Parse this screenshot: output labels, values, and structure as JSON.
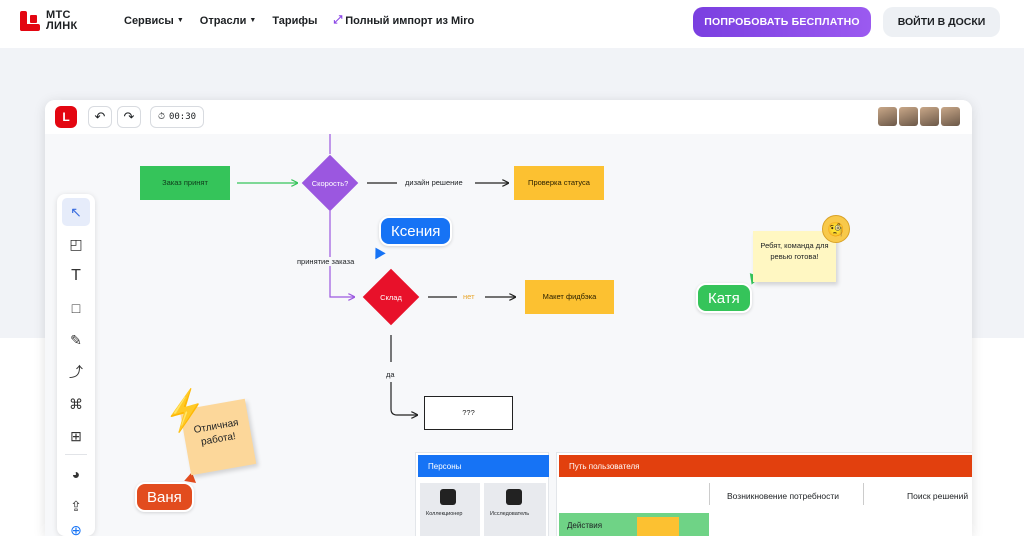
{
  "logo": {
    "line1": "МТС",
    "line2": "ЛИНК"
  },
  "nav": {
    "services": "Сервисы",
    "industries": "Отрасли",
    "pricing": "Тарифы",
    "import": "Полный импорт из Miro"
  },
  "buttons": {
    "try": "ПОПРОБОВАТЬ БЕСПЛАТНО",
    "login": "ВОЙТИ В ДОСКИ"
  },
  "board": {
    "timer": "00:30",
    "nodes": {
      "order": "Заказ принят",
      "speed": "Скорость?",
      "check": "Проверка статуса",
      "warehouse": "Склад",
      "mockup": "Макет фидбэка",
      "unknown": "???"
    },
    "edges": {
      "design": "дизайн решение",
      "accept": "принятие заказа",
      "no": "нет",
      "yes": "да"
    },
    "cursors": {
      "ksenia": "Ксения",
      "katya": "Катя",
      "vanya": "Ваня"
    },
    "stickies": {
      "team": "Ребят, команда для ревью готова!",
      "great": "Отличная работа!"
    },
    "panels": {
      "personas": "Персоны",
      "journey": "Путь пользователя",
      "persona1": "Коллекционер",
      "persona2": "Исследователь",
      "col1": "Возникновение потребности",
      "col2": "Поиск решений",
      "row1": "Действия"
    }
  },
  "colors": {
    "brand": "#e30611",
    "accent": "#8a45e6",
    "green": "#35c45a",
    "yellow": "#fcc131",
    "purple": "#9b57e0",
    "blue": "#1673f5"
  }
}
